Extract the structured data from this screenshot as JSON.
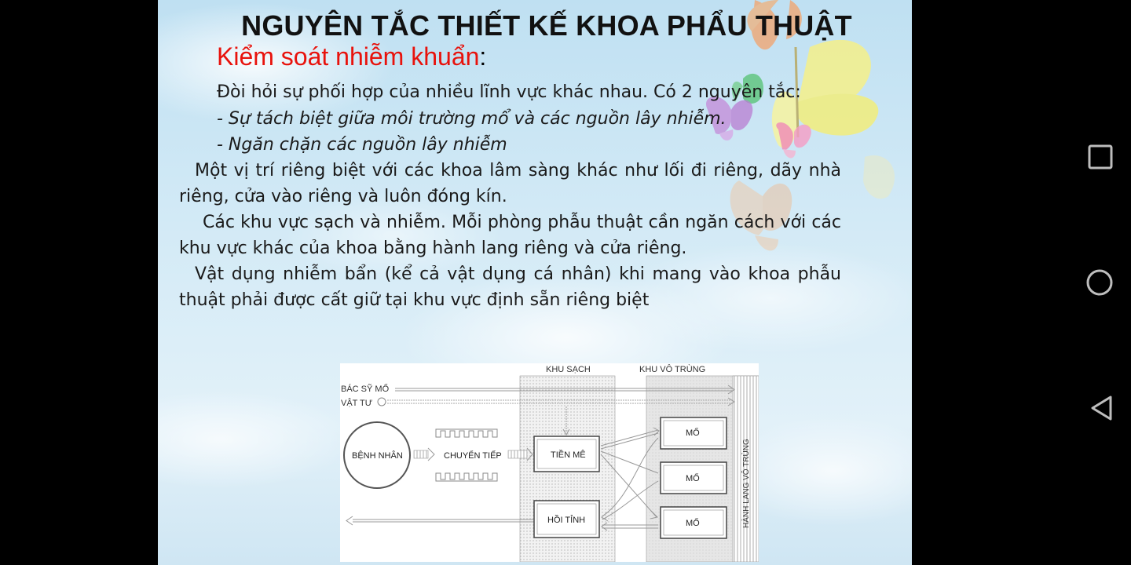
{
  "slide": {
    "title": "NGUYÊN TẮC THIẾT KẾ KHOA PHẨU THUẬT",
    "subtitle_red": "Kiểm soát nhiễm khuẩn",
    "subtitle_suffix": ":",
    "intro": "Đòi hỏi sự phối hợp của nhiều lĩnh vực khác nhau. Có 2 nguyên tắc:",
    "bullet1": "- Sự tách biệt giữa môi trường mổ và các nguồn lây nhiễm.",
    "bullet2": "- Ngăn chặn các nguồn lây nhiễm",
    "para1": "Một vị trí riêng biệt với các khoa lâm sàng khác như lối đi riêng, dãy nhà riêng, cửa vào riêng và luôn đóng kín.",
    "para2": "Các khu vực sạch và nhiễm. Mỗi phòng phẫu thuật cần ngăn cách với các khu vực khác của khoa bằng hành lang riêng và cửa riêng.",
    "para3": "Vật dụng nhiễm bẩn (kể cả vật dụng cá nhân) khi mang vào khoa phẫu thuật phải được cất giữ tại khu vực định sẵn riêng biệt"
  },
  "diagram": {
    "zone_clean": "KHU SẠCH",
    "zone_sterile": "KHU VÔ TRÙNG",
    "doctor": "BÁC SỸ MỔ",
    "supplies": "VẬT TƯ",
    "patient": "BỆNH NHÂN",
    "transfer": "CHUYỂN TIẾP",
    "preanesthesia": "TIỀN MÊ",
    "recovery": "HỒI TỈNH",
    "or1": "MỔ",
    "or2": "MỔ",
    "or3": "MỔ",
    "sterile_corridor": "HÀNH LANG VÔ TRÙNG"
  },
  "nav": {
    "recents_icon": "square-icon",
    "home_icon": "circle-icon",
    "back_icon": "triangle-back-icon"
  }
}
